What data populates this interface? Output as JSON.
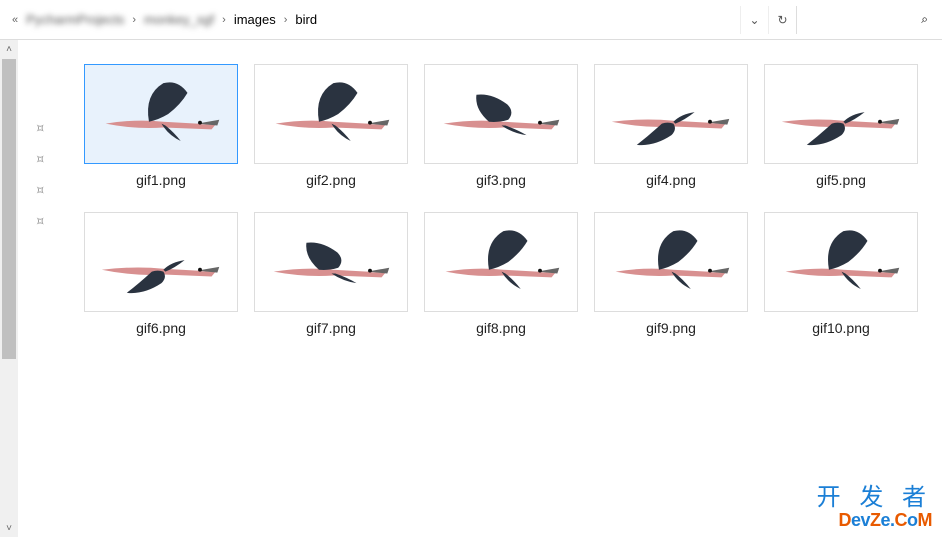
{
  "breadcrumb": {
    "items": [
      {
        "label": "PycharmProjects",
        "blurred": true
      },
      {
        "label": "monkey_sgf",
        "blurred": true
      },
      {
        "label": "images",
        "blurred": false
      },
      {
        "label": "bird",
        "blurred": false
      }
    ]
  },
  "files": [
    {
      "name": "gif1.png",
      "selected": true,
      "pose": "up"
    },
    {
      "name": "gif2.png",
      "selected": false,
      "pose": "up"
    },
    {
      "name": "gif3.png",
      "selected": false,
      "pose": "mid"
    },
    {
      "name": "gif4.png",
      "selected": false,
      "pose": "down"
    },
    {
      "name": "gif5.png",
      "selected": false,
      "pose": "down"
    },
    {
      "name": "gif6.png",
      "selected": false,
      "pose": "down"
    },
    {
      "name": "gif7.png",
      "selected": false,
      "pose": "mid"
    },
    {
      "name": "gif8.png",
      "selected": false,
      "pose": "up"
    },
    {
      "name": "gif9.png",
      "selected": false,
      "pose": "up"
    },
    {
      "name": "gif10.png",
      "selected": false,
      "pose": "up"
    }
  ],
  "watermark": {
    "cn": "开 发 者",
    "en_parts": [
      "D",
      "ev",
      "Z",
      "e.",
      "C",
      "o",
      "M"
    ]
  },
  "icons": {
    "sep": "›",
    "chevron_down": "⌄",
    "refresh": "↻",
    "search": "⌕",
    "pin": "📌",
    "up": "˄",
    "down": "˅",
    "back": "«"
  }
}
